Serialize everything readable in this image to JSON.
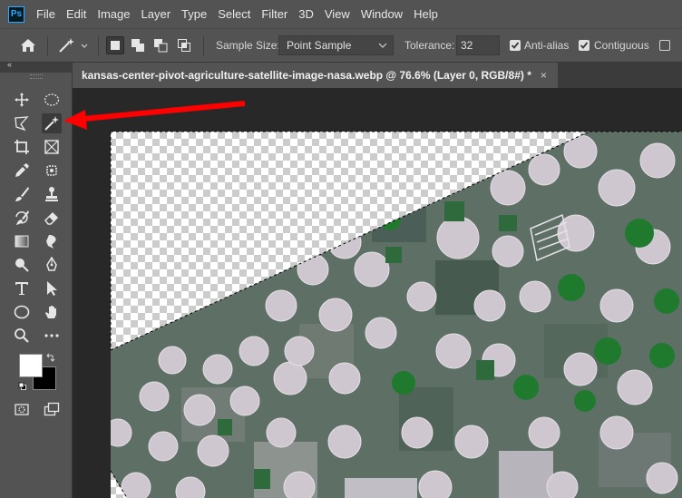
{
  "menubar": {
    "app_logo": "Ps",
    "items": [
      "File",
      "Edit",
      "Image",
      "Layer",
      "Type",
      "Select",
      "Filter",
      "3D",
      "View",
      "Window",
      "Help"
    ]
  },
  "options": {
    "sample_size_label": "Sample Size:",
    "sample_size_value": "Point Sample",
    "tolerance_label": "Tolerance:",
    "tolerance_value": "32",
    "antialias_label": "Anti-alias",
    "antialias_checked": true,
    "contiguous_label": "Contiguous",
    "contiguous_checked": true,
    "sample_all_checked": false
  },
  "document": {
    "tab_title": "kansas-center-pivot-agriculture-satellite-image-nasa.webp @ 76.6% (Layer 0, RGB/8#) *",
    "close_glyph": "×"
  },
  "toolbar": {
    "collapse_glyph": "‹‹",
    "selected_tool": "magic-wand-tool",
    "foreground_color": "#ffffff",
    "background_color": "#000000"
  },
  "annotation": {
    "arrow_color": "#ff0000"
  },
  "colors": {
    "accent": "#31a8ff",
    "panel": "#535353",
    "workspace": "#282828"
  }
}
